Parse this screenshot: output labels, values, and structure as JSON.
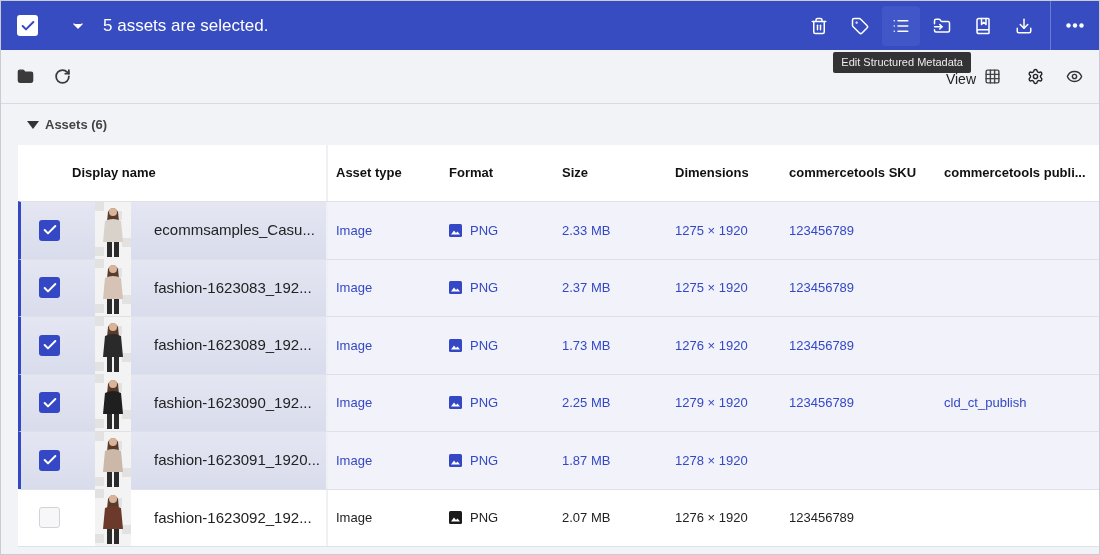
{
  "selection_bar": {
    "checked": true,
    "message": "5 assets are selected.",
    "actions": [
      {
        "kind": "delete",
        "selected": false
      },
      {
        "kind": "tag",
        "selected": false
      },
      {
        "kind": "metadata",
        "selected": true
      },
      {
        "kind": "move",
        "selected": false
      },
      {
        "kind": "collection",
        "selected": false
      },
      {
        "kind": "download",
        "selected": false
      }
    ],
    "tooltip": "Edit Structured Metadata"
  },
  "toolbar": {
    "view_label": "View"
  },
  "section": {
    "title": "Assets (6)",
    "expanded": true
  },
  "table": {
    "columns": [
      "Display name",
      "Asset type",
      "Format",
      "Size",
      "Dimensions",
      "commercetools SKU",
      "commercetools publi..."
    ],
    "rows": [
      {
        "selected": true,
        "name": "ecommsamples_Casu...",
        "asset_type": "Image",
        "format": "PNG",
        "size": "2.33 MB",
        "dimensions": "1275 × 1920",
        "sku": "123456789"
      },
      {
        "selected": true,
        "name": "fashion-1623083_192...",
        "asset_type": "Image",
        "format": "PNG",
        "size": "2.37 MB",
        "dimensions": "1275 × 1920",
        "sku": "123456789"
      },
      {
        "selected": true,
        "name": "fashion-1623089_192...",
        "asset_type": "Image",
        "format": "PNG",
        "size": "1.73 MB",
        "dimensions": "1276 × 1920",
        "sku": "123456789"
      },
      {
        "selected": true,
        "name": "fashion-1623090_192...",
        "asset_type": "Image",
        "format": "PNG",
        "size": "2.25 MB",
        "dimensions": "1279 × 1920",
        "sku": "123456789",
        "publish": "cld_ct_publish"
      },
      {
        "selected": true,
        "name": "fashion-1623091_1920...",
        "asset_type": "Image",
        "format": "PNG",
        "size": "1.87 MB",
        "dimensions": "1278 × 1920"
      },
      {
        "selected": false,
        "name": "fashion-1623092_192...",
        "asset_type": "Image",
        "format": "PNG",
        "size": "2.07 MB",
        "dimensions": "1276 × 1920",
        "sku": "123456789"
      }
    ]
  }
}
